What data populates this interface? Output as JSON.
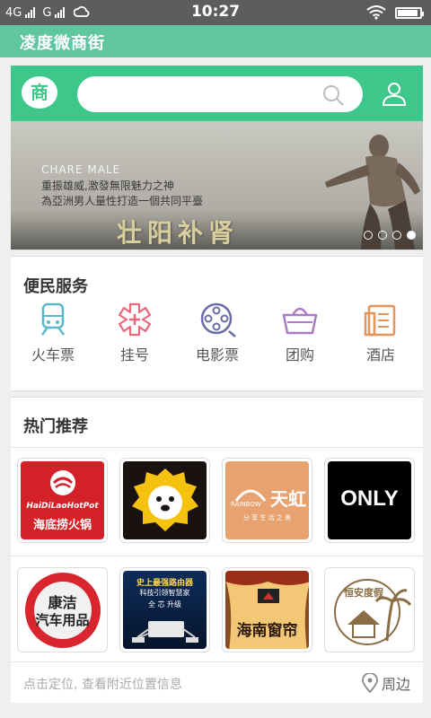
{
  "status_bar": {
    "network_1": "4G",
    "network_2": "G",
    "time": "10:27",
    "battery_level": 0.85
  },
  "app": {
    "title": "凌度微商街"
  },
  "header": {
    "logo_text": "商",
    "search_placeholder": ""
  },
  "banner": {
    "english_text": "CHARE MALE",
    "line_1": "重振雄威,激發無限魅力之神",
    "line_2": "為亞洲男人量性打造一個共同平臺",
    "headline": "壮阳补肾",
    "slide_count": 4,
    "active_slide": 4
  },
  "convenience": {
    "title": "便民服务",
    "items": [
      {
        "label": "火车票",
        "icon": "train-icon",
        "color": "#5bb8c9"
      },
      {
        "label": "挂号",
        "icon": "medical-cross-icon",
        "color": "#e86a7a"
      },
      {
        "label": "电影票",
        "icon": "film-reel-icon",
        "color": "#6b6ba8"
      },
      {
        "label": "团购",
        "icon": "basket-icon",
        "color": "#a97bc2"
      },
      {
        "label": "酒店",
        "icon": "hotel-document-icon",
        "color": "#e0955a"
      }
    ]
  },
  "hot": {
    "title": "热门推荐",
    "row1": [
      {
        "name": "haidilao-tile",
        "line1": "HaiDiLaoHotPot",
        "line2": "海底捞火锅"
      },
      {
        "name": "suning-tile"
      },
      {
        "name": "tianhong-tile",
        "brand_en": "RAINBOW",
        "brand_cn": "天虹",
        "tagline": "分 享 生 活 之 美"
      },
      {
        "name": "only-tile",
        "brand": "ONLY"
      }
    ],
    "row2": [
      {
        "name": "kangjie-tile",
        "line1": "康洁",
        "line2": "汽车用品"
      },
      {
        "name": "router-tile",
        "line1": "史上最强路由器",
        "line2": "科技引领智慧家",
        "line3": "全 芯 升级"
      },
      {
        "name": "hainan-curtain-tile",
        "text": "海南窗帘"
      },
      {
        "name": "hengan-tile",
        "text": "恒安度假"
      }
    ]
  },
  "footer": {
    "hint": "点击定位, 查看附近位置信息",
    "nearby_label": "周边"
  }
}
